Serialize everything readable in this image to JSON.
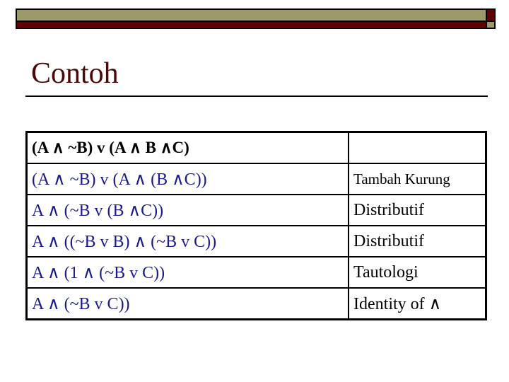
{
  "colors": {
    "olive": "#9c9a6a",
    "maroon": "#600000",
    "title": "#4a0808",
    "expression": "#1a1a8c"
  },
  "title": "Contoh",
  "table": {
    "header": [
      "(A ∧ ~B) v (A ∧ B ∧C)",
      ""
    ],
    "rows": [
      [
        "(A ∧ ~B) v (A ∧ (B ∧C))",
        "Tambah Kurung"
      ],
      [
        "A ∧ (~B v (B ∧C))",
        "Distributif"
      ],
      [
        "A ∧ ((~B v B) ∧ (~B v C))",
        "Distributif"
      ],
      [
        "A ∧ (1 ∧ (~B v C))",
        "Tautologi"
      ],
      [
        "A ∧ (~B v C))",
        "Identity of ∧"
      ]
    ]
  }
}
